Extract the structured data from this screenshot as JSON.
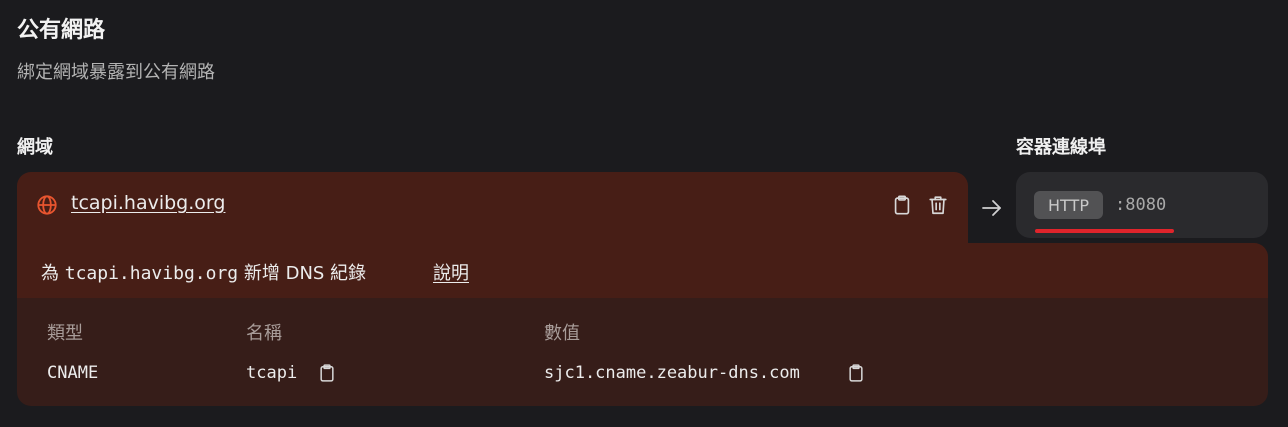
{
  "section": {
    "title": "公有網路",
    "subtitle": "綁定網域暴露到公有網路"
  },
  "labels": {
    "domain": "網域",
    "container_port": "容器連線埠"
  },
  "domain": {
    "hostname": "tcapi.havibg.org",
    "icons": [
      "globe-icon",
      "clipboard-icon",
      "trash-icon"
    ]
  },
  "port": {
    "protocol": "HTTP",
    "value": ":8080"
  },
  "dns": {
    "prefix": "為",
    "hostname": "tcapi.havibg.org",
    "suffix": "新增 DNS 紀錄",
    "help_label": "說明",
    "columns": [
      "類型",
      "名稱",
      "數值"
    ],
    "record": {
      "type": "CNAME",
      "name": "tcapi",
      "value": "sjc1.cname.zeabur-dns.com"
    }
  },
  "colors": {
    "accent_red": "#e0242b",
    "domain_bg": "#471e16",
    "panel_bg": "#361d19"
  }
}
